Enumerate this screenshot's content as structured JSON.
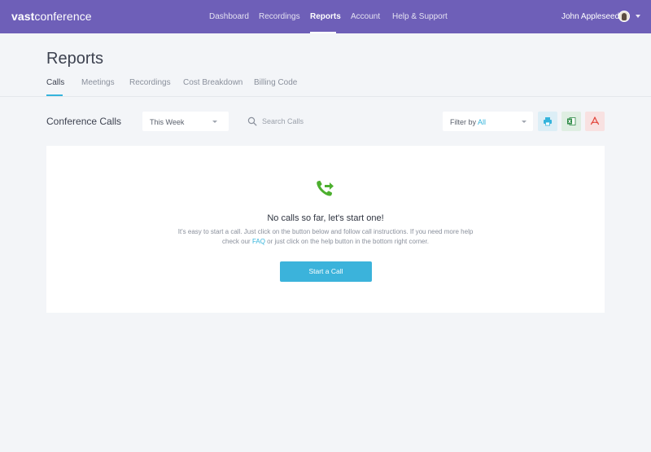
{
  "app": {
    "logo_bold": "vast",
    "logo_rest": "conference"
  },
  "nav": {
    "items": [
      {
        "label": "Dashboard",
        "active": false
      },
      {
        "label": "Recordings",
        "active": false
      },
      {
        "label": "Reports",
        "active": true
      },
      {
        "label": "Account",
        "active": false
      },
      {
        "label": "Help & Support",
        "active": false
      }
    ],
    "user_name": "John Appleseed"
  },
  "page": {
    "title": "Reports",
    "tabs": [
      {
        "label": "Calls",
        "active": true
      },
      {
        "label": "Meetings",
        "active": false
      },
      {
        "label": "Recordings",
        "active": false
      },
      {
        "label": "Cost Breakdown",
        "active": false
      },
      {
        "label": "Billing Code",
        "active": false
      }
    ]
  },
  "toolbar": {
    "section_title": "Conference Calls",
    "period_selected": "This Week",
    "search_placeholder": "Search Calls",
    "filter_label": "Filter by",
    "filter_value": "All",
    "exports": [
      {
        "name": "print-icon",
        "bg": "#dceef6",
        "color": "#35b4dc"
      },
      {
        "name": "excel-icon",
        "bg": "#dfeee2",
        "color": "#2e8b46"
      },
      {
        "name": "pdf-icon",
        "bg": "#f8e1e1",
        "color": "#e2463c"
      }
    ]
  },
  "empty_state": {
    "icon": "phone-forward-icon",
    "title": "No calls so far, let's start one!",
    "line1": "It's easy to start a call. Just click on the button below and follow call instructions. If you need more help",
    "line2_before": "check our ",
    "line2_link": "FAQ",
    "line2_after": " or just click on the help button in the bottom right corner.",
    "button_label": "Start a Call"
  },
  "colors": {
    "topbar": "#6e5fb8",
    "accent": "#35b4dc",
    "icon_green": "#4caf2e"
  }
}
